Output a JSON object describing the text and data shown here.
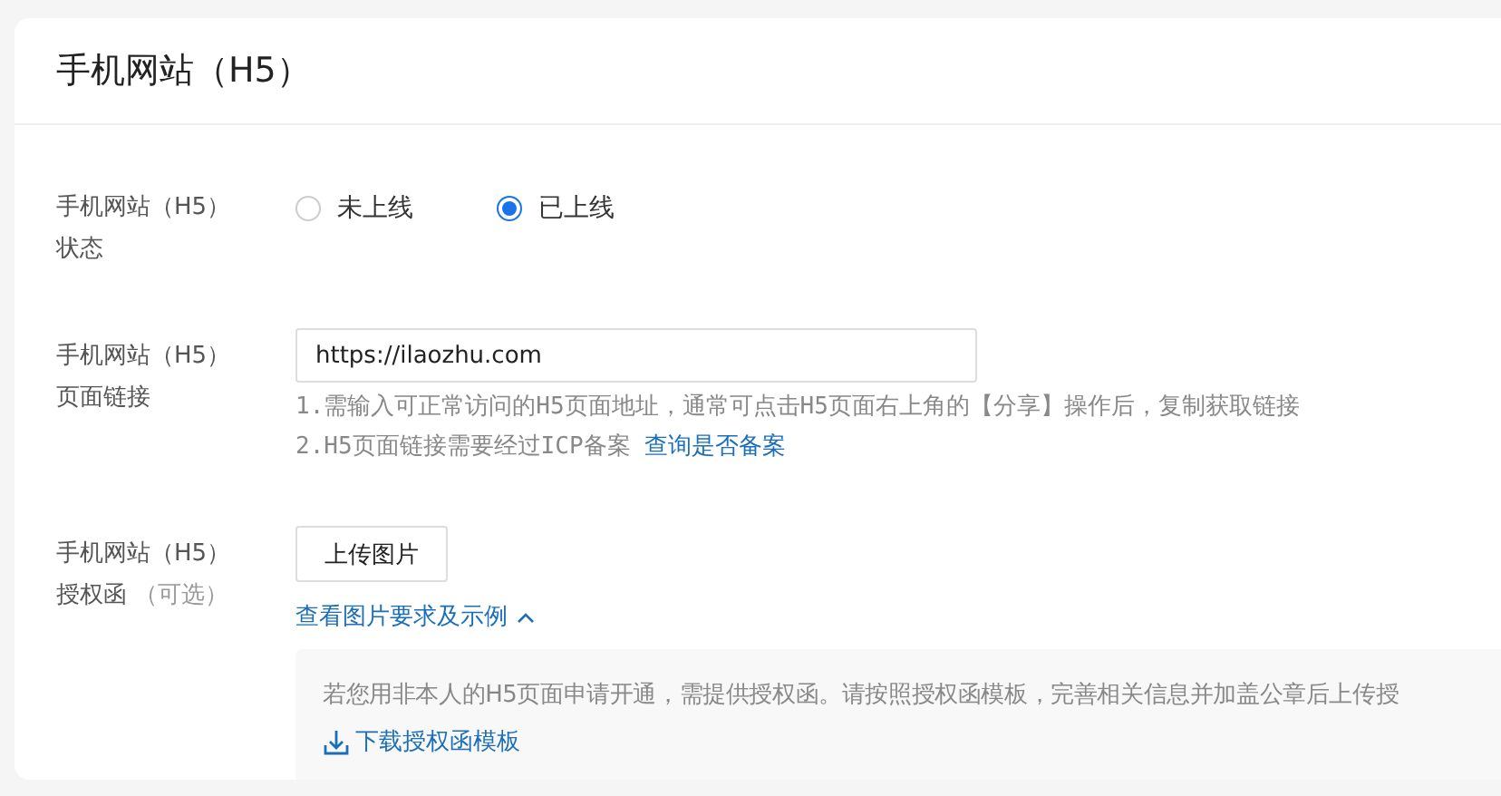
{
  "title": "手机网站（H5）",
  "rows": [
    {
      "kind": "radio",
      "label": [
        "手机网站（H5）",
        "状态"
      ],
      "options": [
        {
          "label": "未上线",
          "selected": false
        },
        {
          "label": "已上线",
          "selected": true
        }
      ]
    },
    {
      "kind": "url",
      "label": [
        "手机网站（H5）",
        "页面链接"
      ],
      "value": "https://ilaozhu.com",
      "hints": [
        {
          "text": "1.需输入可正常访问的H5页面地址，通常可点击H5页面右上角的【分享】操作后，复制获取链接"
        },
        {
          "text": "2.H5页面链接需要经过ICP备案",
          "link": "查询是否备案"
        }
      ]
    },
    {
      "kind": "upload",
      "label": [
        "手机网站（H5）",
        "授权函"
      ],
      "optional": "（可选）",
      "button": "上传图片",
      "toggle": "查看图片要求及示例",
      "expanded": true,
      "notice": "若您用非本人的H5页面申请开通，需提供授权函。请按照授权函模板，完善相关信息并加盖公章后上传授",
      "download": "下载授权函模板"
    }
  ]
}
